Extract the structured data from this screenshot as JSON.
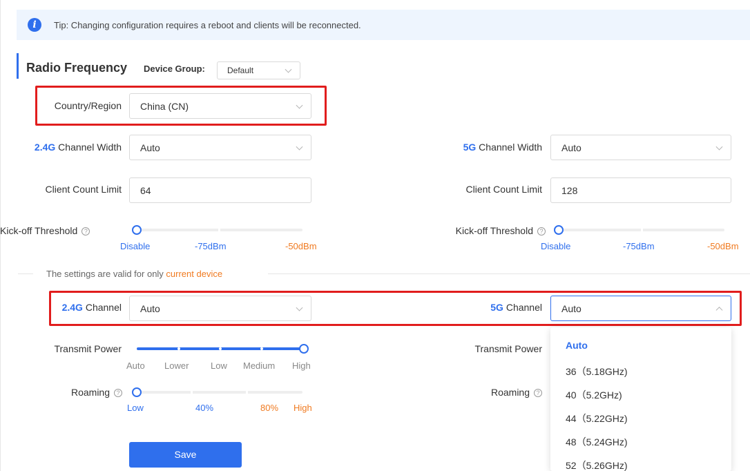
{
  "tip": {
    "icon": "info-icon",
    "text": "Tip: Changing configuration requires a reboot and clients will be reconnected."
  },
  "header": {
    "title": "Radio Frequency",
    "device_group_label": "Device Group:",
    "device_group_value": "Default"
  },
  "country": {
    "label": "Country/Region",
    "value": "China (CN)"
  },
  "band24": {
    "prefix": "2.4G",
    "channel_width_label": " Channel Width",
    "channel_width_value": "Auto",
    "client_limit_label": "Client Count Limit",
    "client_limit_value": "64",
    "kickoff_label": "Kick-off Threshold",
    "kickoff_ticks": [
      "Disable",
      "-75dBm",
      "-50dBm"
    ],
    "channel_label": " Channel",
    "channel_value": "Auto",
    "transmit_label": "Transmit Power",
    "transmit_ticks": [
      "Auto",
      "Lower",
      "Low",
      "Medium",
      "High"
    ],
    "transmit_level": "High",
    "roaming_label": "Roaming",
    "roaming_ticks": [
      "Low",
      "40%",
      "80%",
      "High"
    ]
  },
  "band5": {
    "prefix": "5G",
    "channel_width_label": " Channel Width",
    "channel_width_value": "Auto",
    "client_limit_label": "Client Count Limit",
    "client_limit_value": "128",
    "kickoff_label": "Kick-off Threshold",
    "kickoff_ticks": [
      "Disable",
      "-75dBm",
      "-50dBm"
    ],
    "channel_label": " Channel",
    "channel_value": "Auto",
    "transmit_label": "Transmit Power",
    "roaming_label": "Roaming",
    "channel_options": [
      "Auto",
      "36（5.18GHz)",
      "40（5.2GHz)",
      "44（5.22GHz)",
      "48（5.24GHz)",
      "52（5.26GHz)"
    ]
  },
  "divider": {
    "text": "The settings are valid for only ",
    "highlight": "current device"
  },
  "save_label": "Save",
  "colors": {
    "accent": "#2f6fed",
    "warning": "#f07a20",
    "highlight_box": "#e11d1d"
  },
  "icons": {
    "help": "question-circle-icon",
    "dropdown": "chevron-down-icon"
  }
}
